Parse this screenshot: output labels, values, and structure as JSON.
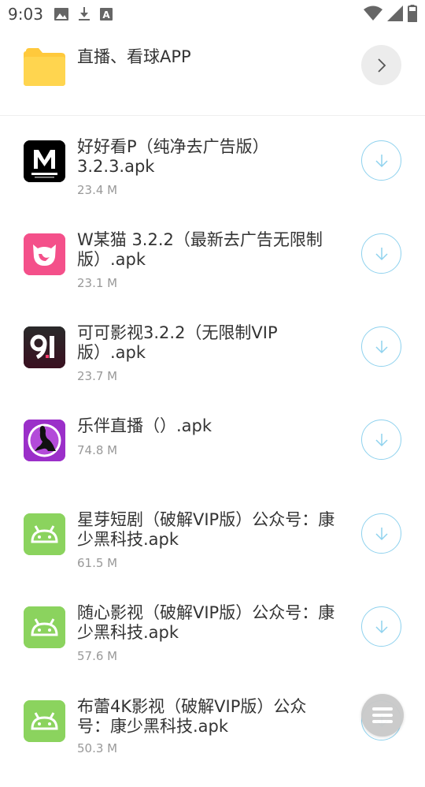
{
  "status_bar": {
    "time": "9:03",
    "icons_left": [
      "image-icon",
      "download-icon",
      "a-badge-icon"
    ],
    "icons_right": [
      "wifi-icon",
      "signal-icon",
      "battery-icon"
    ]
  },
  "folder": {
    "title": "直播、看球APP",
    "icon": "folder-icon",
    "action_icon": "chevron-right-icon",
    "folder_color": "#FFD54F"
  },
  "files": [
    {
      "name_line1": "好好看P（纯净去广告版）",
      "name_line2": "3.2.3.apk",
      "size": "23.4 M",
      "icon": "m-app-icon",
      "icon_bg": "#000000"
    },
    {
      "name_line1": "W某猫 3.2.2（最新去广告无限制",
      "name_line2": "版）.apk",
      "size": "23.1 M",
      "icon": "cat-app-icon",
      "icon_bg": "#F4508A"
    },
    {
      "name_line1": "可可影视3.2.2（无限制VIP",
      "name_line2": "版）.apk",
      "size": "23.7 M",
      "icon": "91-app-icon",
      "icon_bg": "#1A1A1A"
    },
    {
      "name_line1": "乐伴直播（）.apk",
      "name_line2": "",
      "size": "74.8 M",
      "icon": "silhouette-app-icon",
      "icon_bg": "#9B2FC9"
    },
    {
      "name_line1": "星芽短剧（破解VIP版）公众号：康",
      "name_line2": "少黑科技.apk",
      "size": "61.5 M",
      "icon": "android-icon",
      "icon_bg": "#8BD35E"
    },
    {
      "name_line1": "随心影视（破解VIP版）公众号：康",
      "name_line2": "少黑科技.apk",
      "size": "57.6 M",
      "icon": "android-icon",
      "icon_bg": "#8BD35E"
    },
    {
      "name_line1": "布蕾4K影视（破解VIP版）公众",
      "name_line2": "号：康少黑科技.apk",
      "size": "50.3 M",
      "icon": "android-icon",
      "icon_bg": "#8BD35E"
    }
  ],
  "download_icon": "download-arrow-icon",
  "fab_icon": "menu-icon",
  "colors": {
    "accent": "#8FD2EE",
    "text": "#333333",
    "muted": "#999999"
  }
}
